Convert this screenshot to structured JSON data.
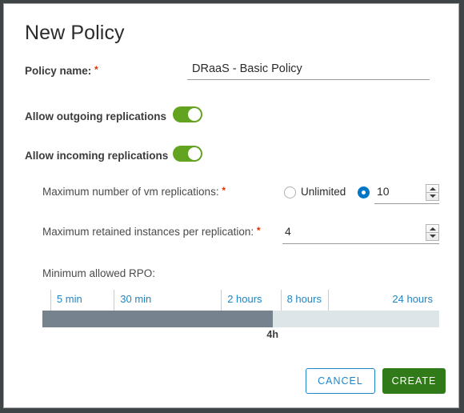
{
  "dialog": {
    "title": "New Policy"
  },
  "policy_name": {
    "label": "Policy name:",
    "required_mark": "*",
    "value": "DRaaS - Basic Policy",
    "placeholder": ""
  },
  "outgoing": {
    "label": "Allow outgoing replications",
    "state": "on"
  },
  "incoming": {
    "label": "Allow incoming replications",
    "state": "on"
  },
  "max_vm_replications": {
    "label": "Maximum number of vm replications:",
    "required_mark": "*",
    "unlimited_label": "Unlimited",
    "unlimited_selected": false,
    "numeric_selected": true,
    "value": "10"
  },
  "max_retained_instances": {
    "label": "Maximum retained instances per replication:",
    "required_mark": "*",
    "value": "4"
  },
  "rpo": {
    "label": "Minimum allowed RPO:",
    "value_label": "4h",
    "fill_percent": 58,
    "ticks": [
      {
        "label": "5 min",
        "left_percent": 2
      },
      {
        "label": "30 min",
        "left_percent": 18
      },
      {
        "label": "2 hours",
        "left_percent": 45
      },
      {
        "label": "8 hours",
        "left_percent": 60
      },
      {
        "label": "24 hours",
        "left_percent": 72
      }
    ]
  },
  "buttons": {
    "cancel": "CANCEL",
    "create": "CREATE"
  },
  "colors": {
    "toggle_on": "#62a420",
    "create_green": "#317a1a",
    "accent_blue": "#1e86c7",
    "radio_blue": "#0076c8",
    "required_red": "#e02f00",
    "slider_fill": "#76838f",
    "slider_track": "#dde5e9"
  }
}
